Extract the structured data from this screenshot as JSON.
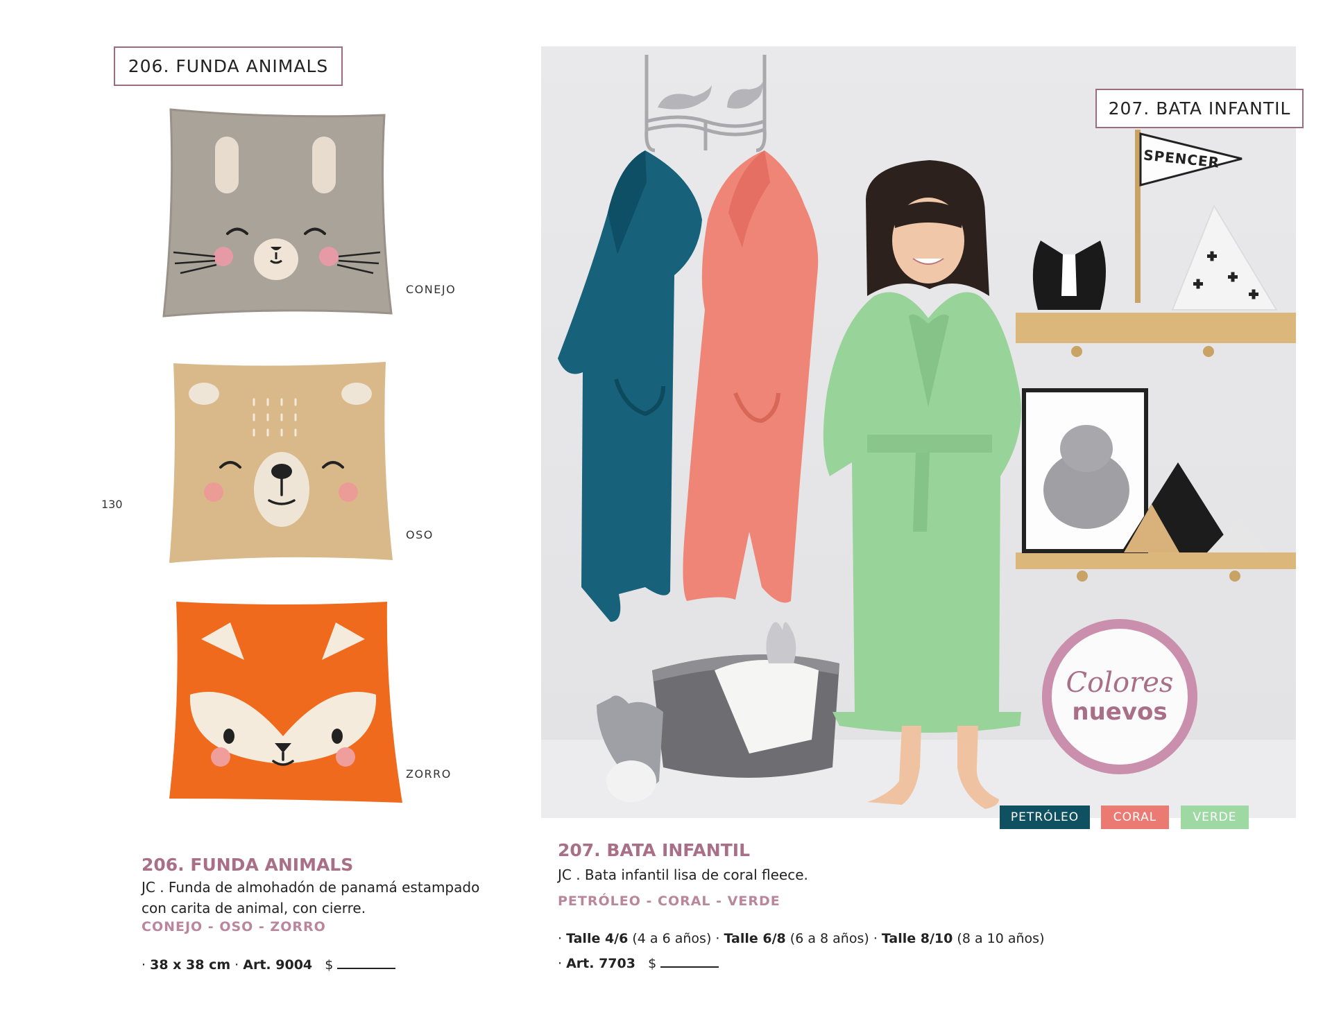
{
  "page_number": "130",
  "left": {
    "label": "206. FUNDA ANIMALS",
    "pillows": [
      {
        "name": "CONEJO"
      },
      {
        "name": "OSO"
      },
      {
        "name": "ZORRO"
      }
    ],
    "title": "206. FUNDA ANIMALS",
    "desc_line1": "JC . Funda de almohadón de panamá estampado",
    "desc_line2": "con carita de animal, con cierre.",
    "colors": "CONEJO - OSO - ZORRO",
    "spec_size": "38 x 38 cm",
    "spec_art": "Art. 9004",
    "currency": "$"
  },
  "right": {
    "label": "207. BATA INFANTIL",
    "flag_text": "SPENCER",
    "badge_line1": "Colores",
    "badge_line2": "nuevos",
    "chips": [
      {
        "label": "PETRÓLEO",
        "color": "#0f5160"
      },
      {
        "label": "CORAL",
        "color": "#ea7a72"
      },
      {
        "label": "VERDE",
        "color": "#9ed9a4"
      }
    ],
    "title": "207. BATA INFANTIL",
    "desc": "JC . Bata infantil lisa de coral fleece.",
    "colors": "PETRÓLEO - CORAL - VERDE",
    "sizes": [
      {
        "talle": "Talle 4/6",
        "range": "(4 a 6 años)"
      },
      {
        "talle": "Talle 6/8",
        "range": "(6 a 8 años)"
      },
      {
        "talle": "Talle 8/10",
        "range": "(8 a 10 años)"
      }
    ],
    "spec_art": "Art. 7703",
    "currency": "$"
  },
  "palette": {
    "accent": "#a86f86",
    "petroleo": "#0f5160",
    "coral": "#ea7a72",
    "verde": "#9ed9a4"
  }
}
